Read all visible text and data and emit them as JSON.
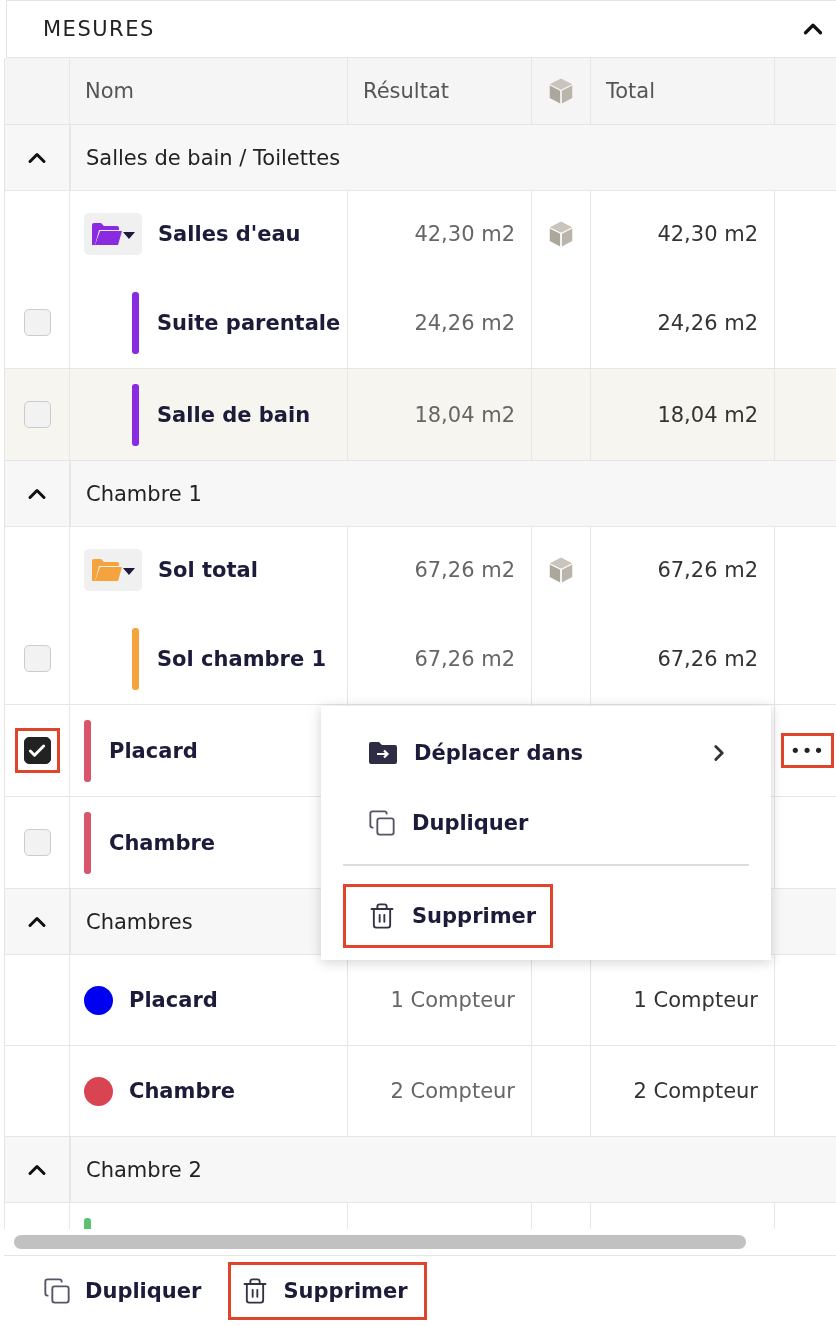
{
  "panel": {
    "title": "MESURES",
    "expanded": true
  },
  "columns": [
    {
      "kind": "name",
      "label": "Nom"
    },
    {
      "kind": "result",
      "label": "Résultat"
    },
    {
      "kind": "cube"
    },
    {
      "kind": "total",
      "label": "Total"
    }
  ],
  "groups": [
    {
      "label": "Salles de bain / Toilettes",
      "expanded": true,
      "rows": [
        {
          "kind": "folder",
          "name": "Salles d'eau",
          "color": "#8a2be2",
          "result": "42,30 m2",
          "cube": true,
          "total": "42,30 m2",
          "children": [
            {
              "kind": "item",
              "name": "Suite parentale",
              "color": "#8a2be2",
              "checked": false,
              "highlighted": false,
              "result": "24,26 m2",
              "total": "24,26 m2"
            },
            {
              "kind": "item",
              "name": "Salle de bain",
              "color": "#8a2be2",
              "checked": false,
              "highlighted": true,
              "result": "18,04 m2",
              "total": "18,04 m2"
            }
          ]
        }
      ]
    },
    {
      "label": "Chambre 1",
      "expanded": true,
      "rows": [
        {
          "kind": "folder",
          "name": "Sol total",
          "color": "#f5a33c",
          "result": "67,26 m2",
          "cube": true,
          "total": "67,26 m2",
          "children": [
            {
              "kind": "item",
              "name": "Sol chambre 1",
              "color": "#f5a33c",
              "checked": false,
              "highlighted": false,
              "result": "67,26 m2",
              "total": "67,26 m2"
            }
          ]
        },
        {
          "kind": "item",
          "name": "Placard",
          "color": "#d9566a",
          "checked": true,
          "annotated": true,
          "highlighted": false,
          "more": {
            "label": "•••",
            "annotated": true
          }
        },
        {
          "kind": "item",
          "name": "Chambre",
          "color": "#d9566a",
          "checked": false,
          "highlighted": false
        }
      ]
    },
    {
      "label": "Chambres",
      "expanded": true,
      "rows": [
        {
          "kind": "counter",
          "name": "Placard",
          "color": "#0000f0",
          "result": "1 Compteur",
          "total": "1 Compteur"
        },
        {
          "kind": "counter",
          "name": "Chambre",
          "color": "#d94452",
          "result": "2 Compteur",
          "total": "2 Compteur"
        }
      ]
    },
    {
      "label": "Chambre 2",
      "expanded": true,
      "rows": [
        {
          "kind": "item",
          "color": "#5cc26b",
          "highlighted": false
        }
      ]
    }
  ],
  "context_menu": {
    "items": [
      {
        "kind": "move",
        "label": "Déplacer dans",
        "annotated": false
      },
      {
        "kind": "duplicate",
        "label": "Dupliquer",
        "annotated": false
      },
      {
        "kind": "separator"
      },
      {
        "kind": "delete",
        "label": "Supprimer",
        "annotated": true
      }
    ]
  },
  "footer": {
    "buttons": [
      {
        "kind": "duplicate",
        "label": "Dupliquer",
        "annotated": false
      },
      {
        "kind": "delete",
        "label": "Supprimer",
        "annotated": true
      }
    ]
  }
}
